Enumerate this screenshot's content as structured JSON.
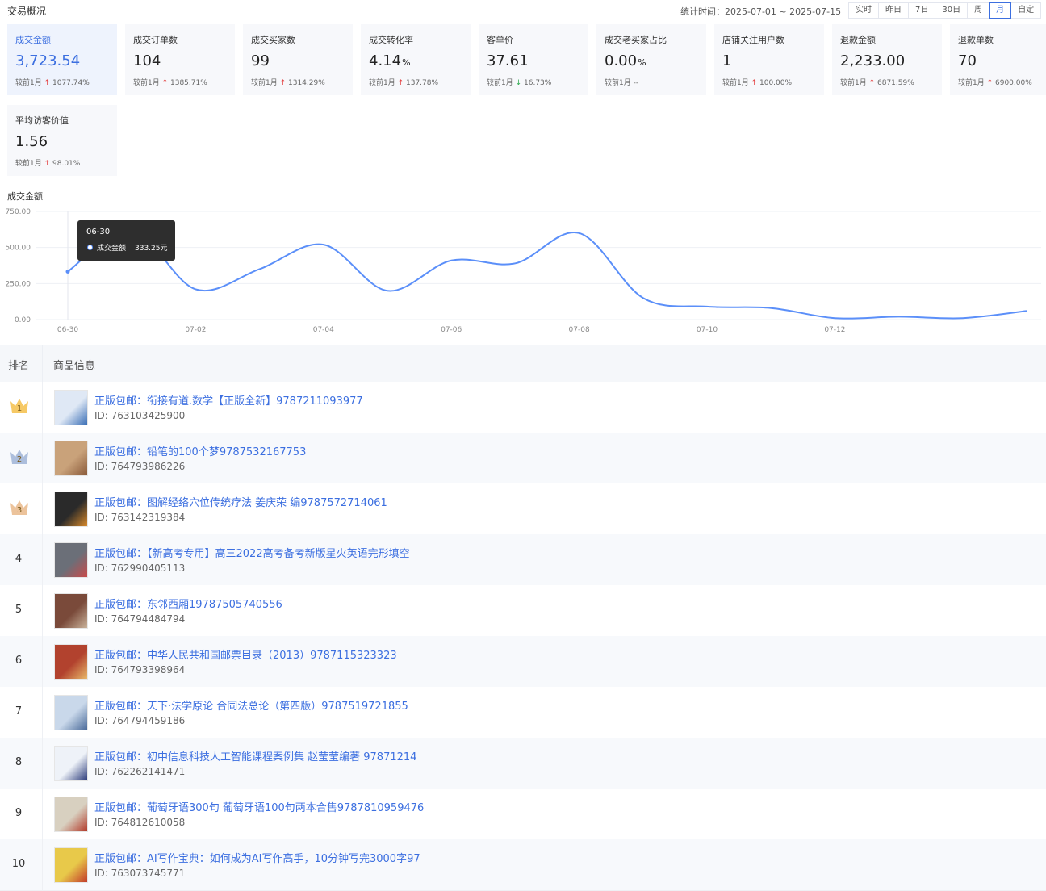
{
  "header": {
    "title": "交易概况",
    "stat_time": "统计时间：2025-07-01 ~ 2025-07-15",
    "range_buttons": [
      "实时",
      "昨日",
      "7日",
      "30日",
      "周",
      "月",
      "自定"
    ],
    "active_range": "月"
  },
  "metrics": [
    {
      "label": "成交金额",
      "value": "3,723.54",
      "unit": "",
      "compare_label": "较前1月",
      "trend": "up",
      "change": "1077.74%",
      "active": true
    },
    {
      "label": "成交订单数",
      "value": "104",
      "unit": "",
      "compare_label": "较前1月",
      "trend": "up",
      "change": "1385.71%",
      "active": false
    },
    {
      "label": "成交买家数",
      "value": "99",
      "unit": "",
      "compare_label": "较前1月",
      "trend": "up",
      "change": "1314.29%",
      "active": false
    },
    {
      "label": "成交转化率",
      "value": "4.14",
      "unit": "%",
      "compare_label": "较前1月",
      "trend": "up",
      "change": "137.78%",
      "active": false
    },
    {
      "label": "客单价",
      "value": "37.61",
      "unit": "",
      "compare_label": "较前1月",
      "trend": "down",
      "change": "16.73%",
      "active": false
    },
    {
      "label": "成交老买家占比",
      "value": "0.00",
      "unit": "%",
      "compare_label": "较前1月",
      "trend": "none",
      "change": "--",
      "active": false
    },
    {
      "label": "店铺关注用户数",
      "value": "1",
      "unit": "",
      "compare_label": "较前1月",
      "trend": "up",
      "change": "100.00%",
      "active": false
    },
    {
      "label": "退款金额",
      "value": "2,233.00",
      "unit": "",
      "compare_label": "较前1月",
      "trend": "up",
      "change": "6871.59%",
      "active": false
    },
    {
      "label": "退款单数",
      "value": "70",
      "unit": "",
      "compare_label": "较前1月",
      "trend": "up",
      "change": "6900.00%",
      "active": false
    },
    {
      "label": "平均访客价值",
      "value": "1.56",
      "unit": "",
      "compare_label": "较前1月",
      "trend": "up",
      "change": "98.01%",
      "active": false
    }
  ],
  "icons": {
    "up": "arrow-up-icon",
    "down": "arrow-down-icon",
    "crown": "crown-icon"
  },
  "colors": {
    "accent": "#3c6fe0",
    "up": "#e33c3c",
    "down": "#2faa4f",
    "line": "#5b8ff9",
    "gold": "#f5c04a",
    "silver": "#9fb4d6",
    "bronze": "#e9b88a"
  },
  "chart_data": {
    "type": "line",
    "title": "成交金额",
    "x": [
      "06-30",
      "07-01",
      "07-02",
      "07-03",
      "07-04",
      "07-05",
      "07-06",
      "07-07",
      "07-08",
      "07-09",
      "07-10",
      "07-11",
      "07-12",
      "07-13",
      "07-14",
      "07-15"
    ],
    "y": [
      333.25,
      620,
      210,
      350,
      520,
      200,
      410,
      390,
      600,
      150,
      90,
      80,
      10,
      20,
      10,
      60
    ],
    "xticks": [
      "06-30",
      "07-02",
      "07-04",
      "07-06",
      "07-08",
      "07-10",
      "07-12"
    ],
    "yticks": [
      "750.00",
      "500.00",
      "250.00",
      "0.00"
    ],
    "ylim": [
      0,
      750
    ],
    "grid": true,
    "tooltip": {
      "date": "06-30",
      "label": "成交金额",
      "value": "333.25元"
    }
  },
  "table": {
    "headers": {
      "rank": "排名",
      "info": "商品信息"
    },
    "rows": [
      {
        "rank": "1",
        "name": "正版包邮：衔接有道.数学【正版全新】9787211093977",
        "id": "ID: 763103425900",
        "thumb": [
          "#dfe8f5",
          "#3b6fb6"
        ]
      },
      {
        "rank": "2",
        "name": "正版包邮：铅笔的100个梦9787532167753",
        "id": "ID: 764793986226",
        "thumb": [
          "#c9a27a",
          "#8a5a3a"
        ]
      },
      {
        "rank": "3",
        "name": "正版包邮：图解经络穴位传统疗法 姜庆荣 编9787572714061",
        "id": "ID: 763142319384",
        "thumb": [
          "#2a2a2a",
          "#d98a2b"
        ]
      },
      {
        "rank": "4",
        "name": "正版包邮：【新高考专用】高三2022高考备考新版星火英语完形填空",
        "id": "ID: 762990405113",
        "thumb": [
          "#6b6f78",
          "#c94a4a"
        ]
      },
      {
        "rank": "5",
        "name": "正版包邮：东邻西厢19787505740556",
        "id": "ID: 764794484794",
        "thumb": [
          "#7a4a3a",
          "#c9b29a"
        ]
      },
      {
        "rank": "6",
        "name": "正版包邮：中华人民共和国邮票目录（2013）9787115323323",
        "id": "ID: 764793398964",
        "thumb": [
          "#b2422e",
          "#e8b86a"
        ]
      },
      {
        "rank": "7",
        "name": "正版包邮：天下·法学原论 合同法总论（第四版）9787519721855",
        "id": "ID: 764794459186",
        "thumb": [
          "#c9d8ea",
          "#4a6a9a"
        ]
      },
      {
        "rank": "8",
        "name": "正版包邮：初中信息科技人工智能课程案例集 赵莹莹编著 97871214",
        "id": "ID: 762262141471",
        "thumb": [
          "#eef2f8",
          "#2a3a7a"
        ]
      },
      {
        "rank": "9",
        "name": "正版包邮：葡萄牙语300句 葡萄牙语100句两本合售9787810959476",
        "id": "ID: 764812610058",
        "thumb": [
          "#d8d0c0",
          "#b23a2a"
        ]
      },
      {
        "rank": "10",
        "name": "正版包邮：AI写作宝典：如何成为AI写作高手，10分钟写完3000字97",
        "id": "ID: 763073745771",
        "thumb": [
          "#e8c94a",
          "#c23a2a"
        ]
      }
    ]
  }
}
